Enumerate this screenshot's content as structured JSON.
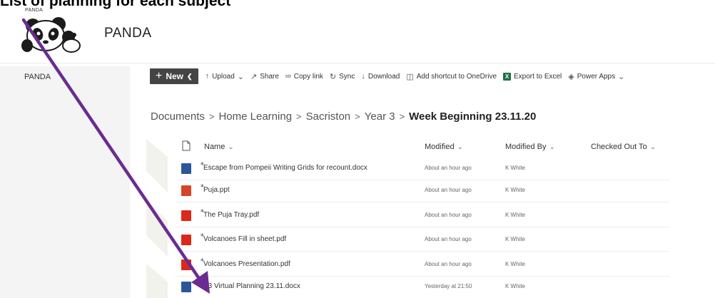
{
  "page_heading": "List of planning for each subject",
  "header": {
    "tiny_label": "PANDA",
    "site_title": "PANDA"
  },
  "nav": {
    "items": [
      {
        "label": "PANDA"
      }
    ]
  },
  "commands": {
    "new": "New",
    "upload": "Upload",
    "share": "Share",
    "copy_link": "Copy link",
    "sync": "Sync",
    "download": "Download",
    "add_shortcut": "Add shortcut to OneDrive",
    "export_excel": "Export to Excel",
    "power_apps": "Power Apps"
  },
  "breadcrumb": {
    "items": [
      "Documents",
      "Home Learning",
      "Sacriston",
      "Year 3"
    ],
    "current": "Week Beginning 23.11.20",
    "separator": ">"
  },
  "table": {
    "headers": {
      "name": "Name",
      "modified": "Modified",
      "modified_by": "Modified By",
      "checked_out": "Checked Out To"
    },
    "rows": [
      {
        "name": "Escape from Pompeii Writing Grids for recount.docx",
        "modified": "About an hour ago",
        "by": "K White",
        "type": "docx"
      },
      {
        "name": "Puja.ppt",
        "modified": "About an hour ago",
        "by": "K White",
        "type": "ppt"
      },
      {
        "name": "The Puja Tray.pdf",
        "modified": "About an hour ago",
        "by": "K White",
        "type": "pdf"
      },
      {
        "name": "Volcanoes Fill in sheet.pdf",
        "modified": "About an hour ago",
        "by": "K White",
        "type": "pdf"
      },
      {
        "name": "Volcanoes Presentation.pdf",
        "modified": "About an hour ago",
        "by": "K White",
        "type": "pdf"
      },
      {
        "name": "Y3 Virtual Planning 23.11.docx",
        "modified": "Yesterday at 21:50",
        "by": "K White",
        "type": "docx"
      }
    ]
  },
  "colors": {
    "annotation_arrow": "#6a2c91",
    "word_blue": "#2b579a",
    "ppt_orange": "#d24726",
    "pdf_red": "#d9291c",
    "excel_green": "#1e7145"
  }
}
